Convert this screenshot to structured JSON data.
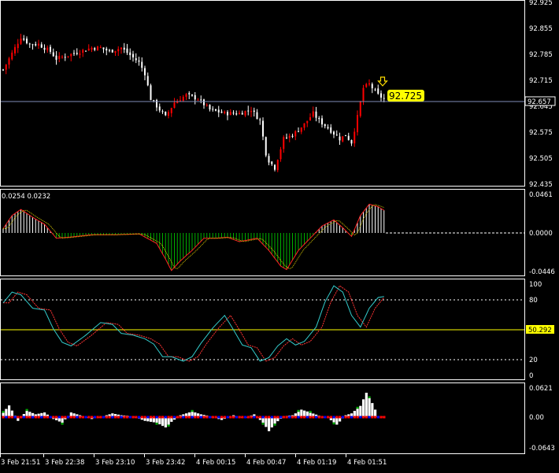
{
  "colors": {
    "background": "#000000",
    "frame": "#ffffff",
    "bull_candle": "#ff0000",
    "bear_candle": "#ffffff",
    "bid_line": "#7f8cb8",
    "price_label_bg": "#ffff00",
    "macd_up_hist": "#ffffff",
    "macd_down_hist": "#00b000",
    "macd_line": "#ff2222",
    "signal_line": "#ddcc00",
    "stoch_main": "#33cccc",
    "stoch_signal": "#ff3333",
    "level_line": "#ffffff",
    "stoch50_line": "#ffff00",
    "bottom_up": "#ffffff",
    "bottom_red": "#ff0000",
    "bottom_blue": "#0000ff",
    "bottom_green": "#00aa00"
  },
  "main": {
    "price_ticks": [
      "92.925",
      "92.855",
      "92.785",
      "92.715",
      "92.645",
      "92.575",
      "92.505",
      "92.435"
    ],
    "bid_label": "92.657",
    "price_label": "92.725",
    "arrow_icon": "down-arrow-icon"
  },
  "macd": {
    "values_text": "0.0254 0.0232",
    "ticks": [
      "0.0461",
      "0.0000",
      "-0.0446"
    ]
  },
  "stoch": {
    "ticks": [
      "100",
      "80",
      "50",
      "20",
      "0"
    ],
    "current_label": "50.292"
  },
  "bottom": {
    "ticks": [
      "0.0621",
      "0.00",
      "-0.0643"
    ]
  },
  "time_axis": {
    "labels": [
      "3 Feb 21:51",
      "3 Feb 22:38",
      "3 Feb 23:10",
      "3 Feb 23:42",
      "4 Feb 00:15",
      "4 Feb 00:47",
      "4 Feb 01:19",
      "4 Feb 01:51"
    ]
  },
  "chart_data": {
    "type": "candlestick",
    "price_range": [
      92.435,
      92.925
    ],
    "bid": 92.657,
    "last_price_marker": 92.725,
    "close_anchors": [
      [
        0,
        92.74
      ],
      [
        4,
        92.8
      ],
      [
        6,
        92.83
      ],
      [
        9,
        92.81
      ],
      [
        12,
        92.81
      ],
      [
        16,
        92.79
      ],
      [
        18,
        92.77
      ],
      [
        22,
        92.78
      ],
      [
        26,
        92.79
      ],
      [
        30,
        92.8
      ],
      [
        33,
        92.8
      ],
      [
        36,
        92.79
      ],
      [
        40,
        92.8
      ],
      [
        43,
        92.78
      ],
      [
        46,
        92.76
      ],
      [
        48,
        92.73
      ],
      [
        50,
        92.66
      ],
      [
        52,
        92.64
      ],
      [
        55,
        92.61
      ],
      [
        58,
        92.65
      ],
      [
        62,
        92.67
      ],
      [
        66,
        92.66
      ],
      [
        70,
        92.63
      ],
      [
        75,
        92.62
      ],
      [
        80,
        92.62
      ],
      [
        84,
        92.63
      ],
      [
        87,
        92.6
      ],
      [
        89,
        92.51
      ],
      [
        90,
        92.49
      ],
      [
        92,
        92.47
      ],
      [
        95,
        92.55
      ],
      [
        98,
        92.56
      ],
      [
        102,
        92.59
      ],
      [
        105,
        92.62
      ],
      [
        107,
        92.6
      ],
      [
        110,
        92.58
      ],
      [
        114,
        92.55
      ],
      [
        116,
        92.56
      ],
      [
        118,
        92.54
      ],
      [
        120,
        92.61
      ],
      [
        122,
        92.69
      ],
      [
        124,
        92.7
      ],
      [
        127,
        92.67
      ],
      [
        129,
        92.66
      ]
    ],
    "macd_anchors": [
      [
        0,
        0.005
      ],
      [
        3,
        0.02
      ],
      [
        6,
        0.027
      ],
      [
        10,
        0.018
      ],
      [
        14,
        0.01
      ],
      [
        18,
        -0.006
      ],
      [
        22,
        -0.005
      ],
      [
        30,
        -0.002
      ],
      [
        38,
        -0.002
      ],
      [
        46,
        -0.001
      ],
      [
        52,
        -0.012
      ],
      [
        55,
        -0.03
      ],
      [
        57,
        -0.043
      ],
      [
        60,
        -0.032
      ],
      [
        64,
        -0.02
      ],
      [
        68,
        -0.006
      ],
      [
        72,
        -0.006
      ],
      [
        76,
        -0.005
      ],
      [
        80,
        -0.01
      ],
      [
        86,
        -0.006
      ],
      [
        90,
        -0.02
      ],
      [
        94,
        -0.038
      ],
      [
        96,
        -0.042
      ],
      [
        100,
        -0.02
      ],
      [
        104,
        -0.006
      ],
      [
        108,
        0.008
      ],
      [
        112,
        0.015
      ],
      [
        115,
        0.006
      ],
      [
        118,
        -0.004
      ],
      [
        121,
        0.02
      ],
      [
        124,
        0.033
      ],
      [
        127,
        0.03
      ],
      [
        129,
        0.026
      ]
    ],
    "stoch_anchors": [
      [
        0,
        80
      ],
      [
        3,
        92
      ],
      [
        6,
        89
      ],
      [
        10,
        74
      ],
      [
        14,
        72
      ],
      [
        17,
        51
      ],
      [
        20,
        36
      ],
      [
        23,
        32
      ],
      [
        28,
        44
      ],
      [
        33,
        58
      ],
      [
        37,
        56
      ],
      [
        40,
        46
      ],
      [
        44,
        44
      ],
      [
        48,
        40
      ],
      [
        51,
        34
      ],
      [
        54,
        20
      ],
      [
        57,
        20
      ],
      [
        61,
        15
      ],
      [
        64,
        20
      ],
      [
        67,
        35
      ],
      [
        71,
        52
      ],
      [
        75,
        66
      ],
      [
        78,
        50
      ],
      [
        81,
        33
      ],
      [
        84,
        30
      ],
      [
        87,
        15
      ],
      [
        90,
        19
      ],
      [
        93,
        32
      ],
      [
        96,
        40
      ],
      [
        99,
        33
      ],
      [
        102,
        37
      ],
      [
        106,
        53
      ],
      [
        109,
        81
      ],
      [
        112,
        99
      ],
      [
        115,
        92
      ],
      [
        118,
        66
      ],
      [
        121,
        53
      ],
      [
        124,
        74
      ],
      [
        127,
        86
      ],
      [
        129,
        87
      ]
    ],
    "bottom_anchors": [
      [
        0,
        0.01
      ],
      [
        2,
        0.025
      ],
      [
        5,
        -0.008
      ],
      [
        8,
        0.014
      ],
      [
        11,
        0.006
      ],
      [
        14,
        0.01
      ],
      [
        17,
        -0.004
      ],
      [
        20,
        -0.012
      ],
      [
        23,
        0.01
      ],
      [
        26,
        0.004
      ],
      [
        30,
        -0.004
      ],
      [
        34,
        0.002
      ],
      [
        37,
        0.008
      ],
      [
        40,
        0.004
      ],
      [
        44,
        0.002
      ],
      [
        48,
        -0.008
      ],
      [
        52,
        -0.012
      ],
      [
        55,
        -0.022
      ],
      [
        57,
        -0.01
      ],
      [
        60,
        0.004
      ],
      [
        64,
        0.012
      ],
      [
        67,
        0.006
      ],
      [
        70,
        0.002
      ],
      [
        74,
        -0.006
      ],
      [
        78,
        0.004
      ],
      [
        82,
        -0.002
      ],
      [
        85,
        0.006
      ],
      [
        88,
        -0.012
      ],
      [
        90,
        -0.03
      ],
      [
        92,
        -0.014
      ],
      [
        95,
        0.002
      ],
      [
        98,
        0.004
      ],
      [
        101,
        0.016
      ],
      [
        104,
        0.01
      ],
      [
        107,
        0.003
      ],
      [
        110,
        -0.002
      ],
      [
        113,
        -0.016
      ],
      [
        116,
        0.004
      ],
      [
        118,
        0.008
      ],
      [
        121,
        0.024
      ],
      [
        123,
        0.052
      ],
      [
        125,
        0.03
      ],
      [
        127,
        0.002
      ],
      [
        129,
        0.001
      ]
    ]
  }
}
